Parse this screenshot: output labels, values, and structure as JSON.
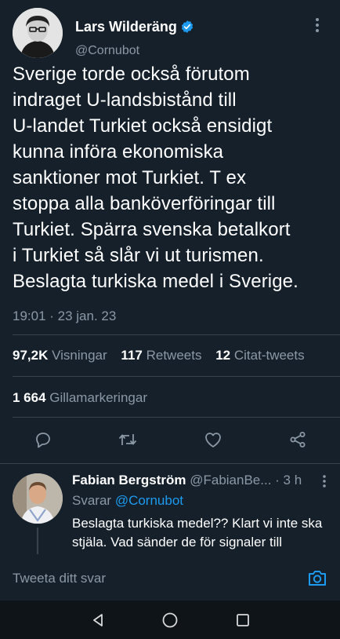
{
  "tweet": {
    "author_name": "Lars Wilderäng",
    "author_handle": "@Cornubot",
    "lines": [
      "Sverige torde också förutom",
      "indraget U-landsbistånd till",
      "U-landet Turkiet också ensidigt",
      "kunna införa ekonomiska",
      "sanktioner mot Turkiet. T ex",
      "stoppa alla banköverföringar till",
      "Turkiet. Spärra svenska betalkort",
      "i Turkiet så slår vi ut turismen.",
      "Beslagta turkiska medel i Sverige."
    ],
    "timestamp": "19:01 · 23 jan. 23",
    "stats": {
      "views_count": "97,2K",
      "views_label": "Visningar",
      "retweets_count": "117",
      "retweets_label": "Retweets",
      "quotes_count": "12",
      "quotes_label": "Citat-tweets",
      "likes_count": "1 664",
      "likes_label": "Gillamarkeringar"
    }
  },
  "reply": {
    "name": "Fabian Bergström",
    "handle": "@FabianBe...",
    "time": "· 3 h",
    "replying_prefix": "Svarar",
    "replying_handle": "@Cornubot",
    "text": "Beslagta turkiska medel?? Klart vi inte ska stjäla. Vad sänder de för signaler till"
  },
  "compose": {
    "placeholder": "Tweeta ditt svar"
  },
  "colors": {
    "background": "#15202b",
    "accent": "#1d9bf0",
    "muted": "#8b98a5",
    "divider": "#38444d"
  },
  "icons": [
    "verified-badge-icon",
    "more-icon",
    "reply-icon",
    "retweet-icon",
    "like-icon",
    "share-icon",
    "camera-icon",
    "nav-back-icon",
    "nav-home-icon",
    "nav-recents-icon"
  ]
}
